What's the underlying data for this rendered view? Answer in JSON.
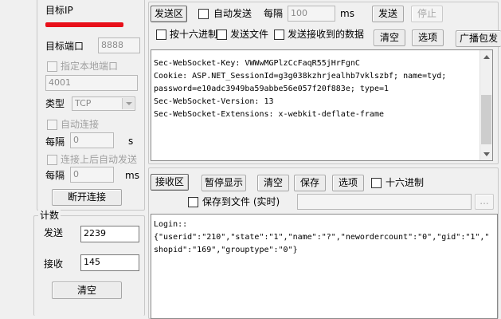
{
  "left": {
    "target_ip_label": "目标IP",
    "target_port_label": "目标端口",
    "target_port_value": "8888",
    "local_port_check_label": "指定本地端口",
    "local_port_value": "4001",
    "type_label": "类型",
    "type_value": "TCP",
    "auto_connect_label": "自动连接",
    "interval1_label": "每隔",
    "interval1_value": "0",
    "interval1_unit": "s",
    "reconnect_label": "连接上后自动发送",
    "interval2_label": "每隔",
    "interval2_value": "0",
    "interval2_unit": "ms",
    "disconnect_button": "断开连接",
    "count_label": "计数",
    "send_label": "发送",
    "send_count": "2239",
    "recv_label": "接收",
    "recv_count": "145",
    "clear_button": "清空"
  },
  "send": {
    "area_label": "发送区",
    "auto_send_label": "自动发送",
    "interval_label": "每隔",
    "interval_value": "100",
    "interval_unit": "ms",
    "send_button": "发送",
    "stop_button": "停止",
    "hex_label": "按十六进制",
    "send_file_label": "发送文件",
    "send_received_label": "发送接收到的数据",
    "clear_button": "清空",
    "options_button": "选项",
    "broadcast_button": "广播包发",
    "lines": [
      "Sec-WebSocket-Key: VWWwMGPlzCcFaqR55jHrFgnC",
      "Cookie: ASP.NET_SessionId=g3g038kzhrjealhb7vklszbf; name=tyd;",
      "password=e10adc3949ba59abbe56e057f20f883e; type=1",
      "Sec-WebSocket-Version: 13",
      "Sec-WebSocket-Extensions: x-webkit-deflate-frame"
    ]
  },
  "recv": {
    "area_label": "接收区",
    "pause_button": "暂停显示",
    "clear_button": "清空",
    "save_button": "保存",
    "options_button": "选项",
    "hex_label": "十六进制",
    "save_file_label": "保存到文件 (实时)",
    "browse_button": "...",
    "lines": [
      "Login::",
      "{\"userid\":\"210\",\"state\":\"1\",\"name\":\"?\",\"newordercount\":\"0\",\"gid\":\"1\",\"",
      "shopid\":\"169\",\"grouptype\":\"0\"}"
    ]
  },
  "colors": {
    "redaction": "#e8101a",
    "window_bg": "#f0f0f0"
  }
}
